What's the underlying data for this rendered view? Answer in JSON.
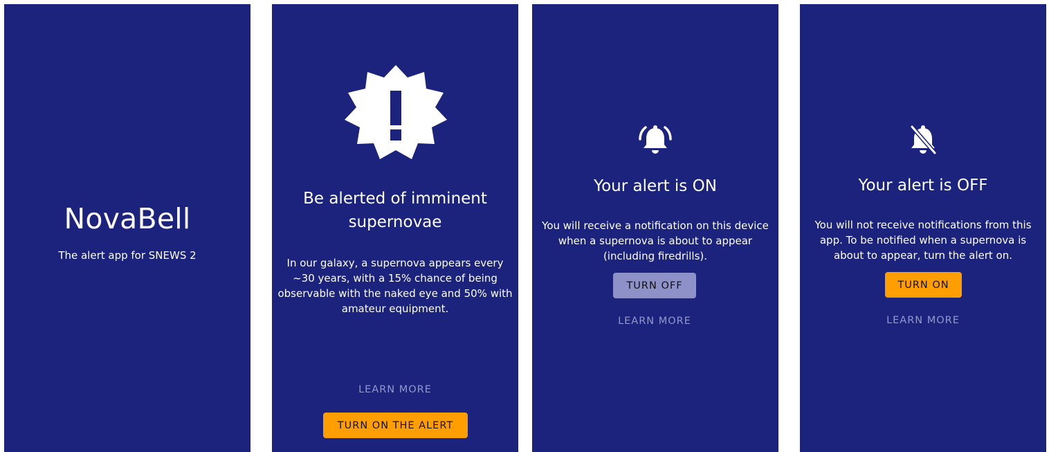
{
  "splash": {
    "title": "NovaBell",
    "subtitle": "The alert app for SNEWS 2"
  },
  "intro": {
    "icon": "alert-badge-icon",
    "headline_line1": "Be alerted of imminent",
    "headline_line2": "supernovae",
    "body_line1": "In our galaxy, a supernova appears every",
    "body_line2": "~30 years, with a 15% chance of being",
    "body_line3": "observable with the naked eye and 50% with",
    "body_line4": "amateur equipment.",
    "learn_more_label": "LEARN MORE",
    "turn_on_label": "TURN ON THE ALERT"
  },
  "alert_on": {
    "icon": "bell-ringing-icon",
    "headline": "Your alert is ON",
    "body_line1": "You will receive a notification on this device",
    "body_line2": "when a supernova is about to appear",
    "body_line3": "(including firedrills).",
    "turn_off_label": "TURN OFF",
    "learn_more_label": "LEARN MORE"
  },
  "alert_off": {
    "icon": "bell-off-icon",
    "headline": "Your alert is OFF",
    "body_line1": "You will not receive notifications from this",
    "body_line2": "app. To be notified when a supernova is",
    "body_line3": "about to appear, turn the alert on.",
    "turn_on_label": "TURN ON",
    "learn_more_label": "LEARN MORE"
  },
  "colors": {
    "background": "#1b237d",
    "accent": "#ff9e00",
    "muted_button": "#8e91c8",
    "text_button": "#9498cb",
    "text": "#ffffff"
  }
}
